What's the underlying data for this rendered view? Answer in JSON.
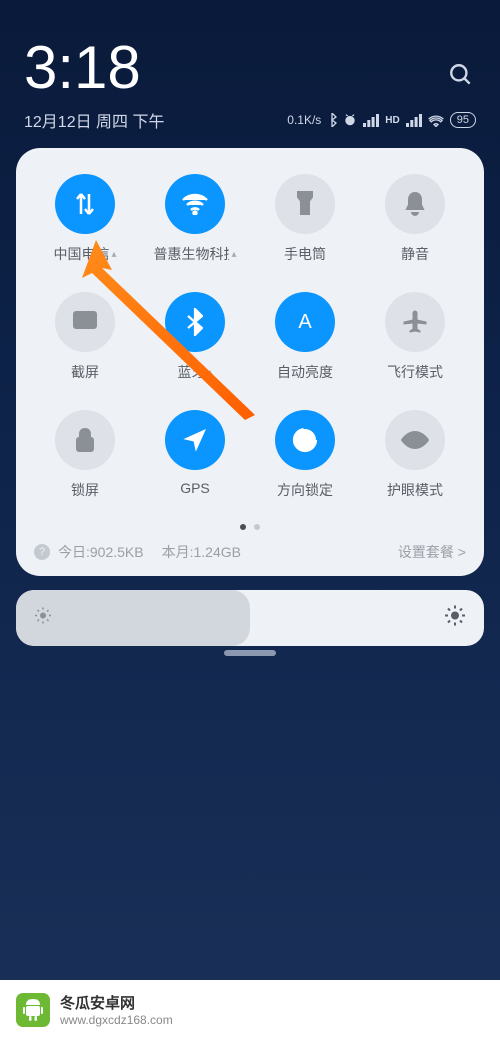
{
  "status": {
    "time": "3:18",
    "date": "12月12日 周四 下午",
    "net_speed": "0.1K/s",
    "hd_label": "HD",
    "battery": "95"
  },
  "tiles": [
    {
      "label": "中国电信",
      "expandable": true,
      "active": true,
      "icon": "data"
    },
    {
      "label": "普惠生物科技",
      "expandable": true,
      "active": true,
      "icon": "wifi"
    },
    {
      "label": "手电筒",
      "expandable": false,
      "active": false,
      "icon": "flashlight"
    },
    {
      "label": "静音",
      "expandable": false,
      "active": false,
      "icon": "bell"
    },
    {
      "label": "截屏",
      "expandable": false,
      "active": false,
      "icon": "screenshot"
    },
    {
      "label": "蓝牙",
      "expandable": true,
      "active": true,
      "icon": "bluetooth"
    },
    {
      "label": "自动亮度",
      "expandable": false,
      "active": true,
      "icon": "auto-brightness"
    },
    {
      "label": "飞行模式",
      "expandable": false,
      "active": false,
      "icon": "airplane"
    },
    {
      "label": "锁屏",
      "expandable": false,
      "active": false,
      "icon": "lock"
    },
    {
      "label": "GPS",
      "expandable": false,
      "active": true,
      "icon": "gps"
    },
    {
      "label": "方向锁定",
      "expandable": false,
      "active": true,
      "icon": "rotation-lock"
    },
    {
      "label": "护眼模式",
      "expandable": false,
      "active": false,
      "icon": "eye"
    }
  ],
  "usage": {
    "today_label": "今日:",
    "today_value": "902.5KB",
    "month_label": "本月:",
    "month_value": "1.24GB",
    "plan_link": "设置套餐 >"
  },
  "footer": {
    "site_name": "冬瓜安卓网",
    "site_url": "www.dgxcdz168.com"
  }
}
